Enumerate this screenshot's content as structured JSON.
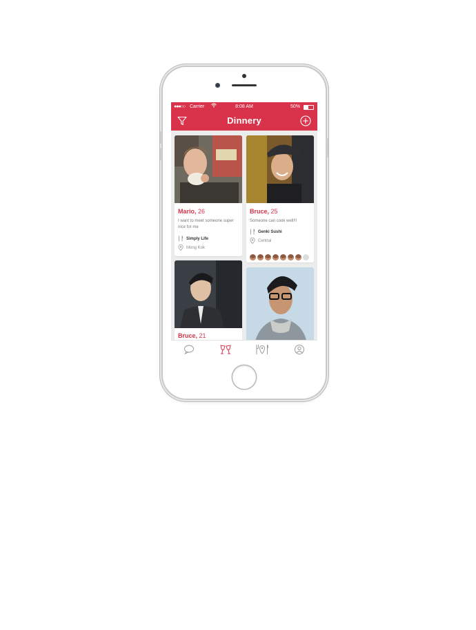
{
  "status_bar": {
    "carrier": "Carrier",
    "time": "8:08 AM",
    "battery": "50%"
  },
  "navbar": {
    "title": "Dinnery"
  },
  "cards": [
    {
      "name": "Mario,",
      "age": "26",
      "bio": "I want to meet someone super nice for me",
      "restaurant": "Simply Life",
      "location": "Mong Kok"
    },
    {
      "name": "Bruce,",
      "age": "25",
      "bio": "Someone can cook well!!!",
      "restaurant": "Genki Sushi",
      "location": "Central"
    },
    {
      "name": "Bruce,",
      "age": "21"
    },
    {
      "name": "",
      "age": ""
    }
  ],
  "colors": {
    "accent": "#d8334a",
    "background": "#ececec"
  },
  "icons": {
    "nav_left": "filter-icon",
    "nav_right": "add-icon",
    "tabs": [
      "chat-icon",
      "cheers-icon",
      "restaurant-map-icon",
      "profile-icon"
    ]
  }
}
